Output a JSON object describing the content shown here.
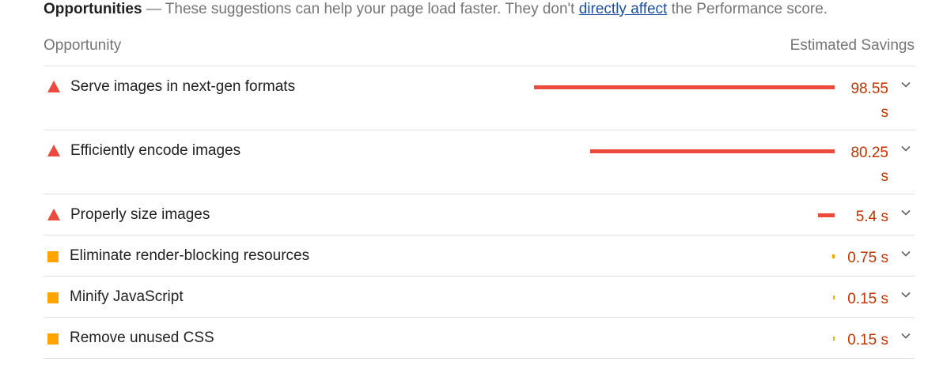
{
  "header": {
    "title": "Opportunities",
    "desc_before": " — These suggestions can help your page load faster. They don't ",
    "link": "directly affect",
    "desc_after": " the Performance score."
  },
  "columns": {
    "opportunity": "Opportunity",
    "savings": "Estimated Savings"
  },
  "rows": [
    {
      "label": "Serve images in next-gen formats",
      "saving": "98.55 s",
      "severity": "fail",
      "icon": "warning-triangle-icon",
      "bar_fraction": 1.0
    },
    {
      "label": "Efficiently encode images",
      "saving": "80.25 s",
      "severity": "fail",
      "icon": "warning-triangle-icon",
      "bar_fraction": 0.814
    },
    {
      "label": "Properly size images",
      "saving": "5.4 s",
      "severity": "fail",
      "icon": "warning-triangle-icon",
      "bar_fraction": 0.055
    },
    {
      "label": "Eliminate render-blocking resources",
      "saving": "0.75 s",
      "severity": "average",
      "icon": "average-square-icon",
      "bar_fraction": 0.008
    },
    {
      "label": "Minify JavaScript",
      "saving": "0.15 s",
      "severity": "average",
      "icon": "average-square-icon",
      "bar_fraction": 0.002
    },
    {
      "label": "Remove unused CSS",
      "saving": "0.15 s",
      "severity": "average",
      "icon": "average-square-icon",
      "bar_fraction": 0.002
    }
  ],
  "colors": {
    "fail": "#eb4a3c",
    "average": "#ffa400",
    "saving_text": "#c33300",
    "link": "#1a4fa3"
  }
}
